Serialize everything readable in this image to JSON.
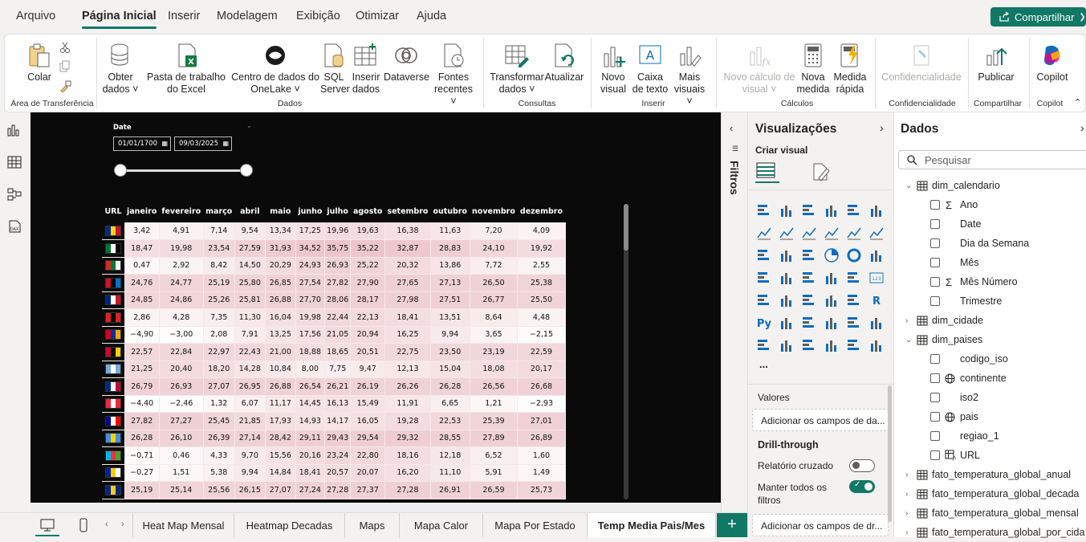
{
  "menu": {
    "items": [
      "Arquivo",
      "Página Inicial",
      "Inserir",
      "Modelagem",
      "Exibição",
      "Otimizar",
      "Ajuda"
    ],
    "share_label": "Compartilhar"
  },
  "ribbon": {
    "colar": "Colar",
    "area_transferencia": "Área de Transferência",
    "obter_dados": "Obter dados",
    "pasta_trabalho": "Pasta de trabalho do Excel",
    "centro_onelake": "Centro de dados do OneLake",
    "sql_server": "SQL Server",
    "inserir_dados": "Inserir dados",
    "dataverse": "Dataverse",
    "fontes_recentes": "Fontes recentes",
    "dados_group": "Dados",
    "transformar_dados": "Transformar dados",
    "atualizar": "Atualizar",
    "consultas_group": "Consultas",
    "novo_visual": "Novo visual",
    "caixa_texto": "Caixa de texto",
    "mais_visuais": "Mais visuais",
    "inserir_group": "Inserir",
    "novo_calculo": "Novo cálculo de visual",
    "nova_medida": "Nova medida",
    "medida_rapida": "Medida rápida",
    "calculos_group": "Cálculos",
    "confidencialidade": "Confidencialidade",
    "confidencialidade_group": "Confidencialidade",
    "publicar": "Publicar",
    "compartilhar_group": "Compartilhar",
    "copilot": "Copilot",
    "copilot_group": "Copilot"
  },
  "slicer": {
    "title": "Date",
    "start": "01/01/1700",
    "end": "09/03/2025"
  },
  "table": {
    "headers": [
      "URL",
      "janeiro",
      "fevereiro",
      "março",
      "abril",
      "maio",
      "junho",
      "julho",
      "agosto",
      "setembro",
      "outubro",
      "novembro",
      "dezembro"
    ],
    "rows": [
      [
        "3,42",
        "4,91",
        "7,14",
        "9,54",
        "13,34",
        "17,25",
        "19,96",
        "19,63",
        "16,38",
        "11,63",
        "7,20",
        "4,09"
      ],
      [
        "18,47",
        "19,98",
        "23,54",
        "27,59",
        "31,93",
        "34,52",
        "35,75",
        "35,22",
        "32,87",
        "28,83",
        "24,10",
        "19,92"
      ],
      [
        "0,47",
        "2,92",
        "8,42",
        "14,50",
        "20,29",
        "24,93",
        "26,93",
        "25,22",
        "20,32",
        "13,86",
        "7,72",
        "2,55"
      ],
      [
        "24,76",
        "24,77",
        "25,19",
        "25,80",
        "26,85",
        "27,54",
        "27,82",
        "27,90",
        "27,65",
        "27,13",
        "26,50",
        "25,38"
      ],
      [
        "24,85",
        "24,86",
        "25,26",
        "25,81",
        "26,88",
        "27,70",
        "28,06",
        "28,17",
        "27,98",
        "27,51",
        "26,77",
        "25,50"
      ],
      [
        "2,86",
        "4,28",
        "7,35",
        "11,30",
        "16,04",
        "19,98",
        "22,44",
        "22,13",
        "18,41",
        "13,51",
        "8,64",
        "4,48"
      ],
      [
        "−4,90",
        "−3,00",
        "2,08",
        "7,91",
        "13,25",
        "17,56",
        "21,05",
        "20,94",
        "16,25",
        "9,94",
        "3,65",
        "−2,15"
      ],
      [
        "22,57",
        "22,84",
        "22,97",
        "22,43",
        "21,00",
        "18,88",
        "18,65",
        "20,51",
        "22,75",
        "23,50",
        "23,19",
        "22,59"
      ],
      [
        "21,25",
        "20,40",
        "18,20",
        "14,28",
        "10,84",
        "8,00",
        "7,75",
        "9,47",
        "12,13",
        "15,04",
        "18,08",
        "20,17"
      ],
      [
        "26,79",
        "26,93",
        "27,07",
        "26,95",
        "26,88",
        "26,54",
        "26,21",
        "26,19",
        "26,26",
        "26,28",
        "26,56",
        "26,68"
      ],
      [
        "−4,40",
        "−2,46",
        "1,32",
        "6,07",
        "11,17",
        "14,45",
        "16,13",
        "15,49",
        "11,91",
        "6,65",
        "1,21",
        "−2,93"
      ],
      [
        "27,82",
        "27,27",
        "25,45",
        "21,85",
        "17,93",
        "14,93",
        "14,17",
        "16,05",
        "19,28",
        "22,53",
        "25,39",
        "27,01"
      ],
      [
        "26,28",
        "26,10",
        "26,39",
        "27,14",
        "28,42",
        "29,11",
        "29,43",
        "29,54",
        "29,32",
        "28,55",
        "27,89",
        "26,89"
      ],
      [
        "−0,71",
        "0,46",
        "4,33",
        "9,70",
        "15,56",
        "20,16",
        "23,24",
        "22,80",
        "18,16",
        "12,18",
        "6,52",
        "1,60"
      ],
      [
        "−0,27",
        "1,51",
        "5,38",
        "9,94",
        "14,84",
        "18,41",
        "20,57",
        "20,07",
        "16,20",
        "11,10",
        "5,91",
        "1,49"
      ],
      [
        "25,19",
        "25,14",
        "25,56",
        "26,15",
        "27,07",
        "27,24",
        "27,28",
        "27,37",
        "27,28",
        "26,91",
        "26,59",
        "25,73"
      ]
    ],
    "flag_colors": [
      [
        "#002b7f",
        "#fcd116",
        "#ce1126"
      ],
      [
        "#00732f",
        "#ffffff",
        "#000000"
      ],
      [
        "#d52b1e",
        "#007a3d",
        "#ffffff"
      ],
      [
        "#ce1126",
        "#000000",
        "#0072c6"
      ],
      [
        "#00247d",
        "#ffffff",
        "#cf142b"
      ],
      [
        "#e41e20",
        "#000000",
        "#e41e20"
      ],
      [
        "#d90012",
        "#0033a0",
        "#f2a800"
      ],
      [
        "#cc092f",
        "#000000",
        "#ffcb00"
      ],
      [
        "#74acdf",
        "#ffffff",
        "#74acdf"
      ],
      [
        "#002b7f",
        "#ffffff",
        "#bf0a30"
      ],
      [
        "#ed2939",
        "#ffffff",
        "#ed2939"
      ],
      [
        "#00008b",
        "#ffffff",
        "#ff0000"
      ],
      [
        "#418fde",
        "#ffd100",
        "#418fde"
      ],
      [
        "#00b5e2",
        "#ef3340",
        "#509e2f"
      ],
      [
        "#002395",
        "#fecb00",
        "#ffffff"
      ],
      [
        "#00267f",
        "#ffc726",
        "#00267f"
      ]
    ]
  },
  "filters": {
    "label": "Filtros"
  },
  "viz": {
    "title": "Visualizações",
    "criar_visual": "Criar visual",
    "more": "...",
    "valores": "Valores",
    "adicionar_campos": "Adicionar os campos de da...",
    "drill_through": "Drill-through",
    "relatorio_cruzado": "Relatório cruzado",
    "manter_filtros": "Manter todos os filtros",
    "adicionar_drill": "Adicionar os campos de dr..."
  },
  "dados": {
    "title": "Dados",
    "search_placeholder": "Pesquisar",
    "tree": [
      {
        "label": "dim_calendario",
        "level": 0,
        "expanded": true
      },
      {
        "label": "Ano",
        "level": 1,
        "sigma": true
      },
      {
        "label": "Date",
        "level": 1
      },
      {
        "label": "Dia da Semana",
        "level": 1
      },
      {
        "label": "Mês",
        "level": 1
      },
      {
        "label": "Mês Número",
        "level": 1,
        "sigma": true
      },
      {
        "label": "Trimestre",
        "level": 1
      },
      {
        "label": "dim_cidade",
        "level": 0,
        "expanded": false
      },
      {
        "label": "dim_paises",
        "level": 0,
        "expanded": true
      },
      {
        "label": "codigo_iso",
        "level": 1
      },
      {
        "label": "continente",
        "level": 1,
        "globe": true
      },
      {
        "label": "iso2",
        "level": 1
      },
      {
        "label": "pais",
        "level": 1,
        "globe": true
      },
      {
        "label": "regiao_1",
        "level": 1
      },
      {
        "label": "URL",
        "level": 1,
        "calc": true
      },
      {
        "label": "fato_temperatura_global_anual",
        "level": 0,
        "expanded": false
      },
      {
        "label": "fato_temperatura_global_decada",
        "level": 0,
        "expanded": false
      },
      {
        "label": "fato_temperatura_global_mensal",
        "level": 0,
        "expanded": false
      },
      {
        "label": "fato_temperatura_global_por_cida",
        "level": 0,
        "expanded": false
      }
    ]
  },
  "tabs": [
    "Heat Map Mensal",
    "Heatmap Decadas",
    "Maps",
    "Mapa Calor",
    "Mapa Por Estado",
    "Temp Media Pais/Mes"
  ],
  "add_tab": "+"
}
